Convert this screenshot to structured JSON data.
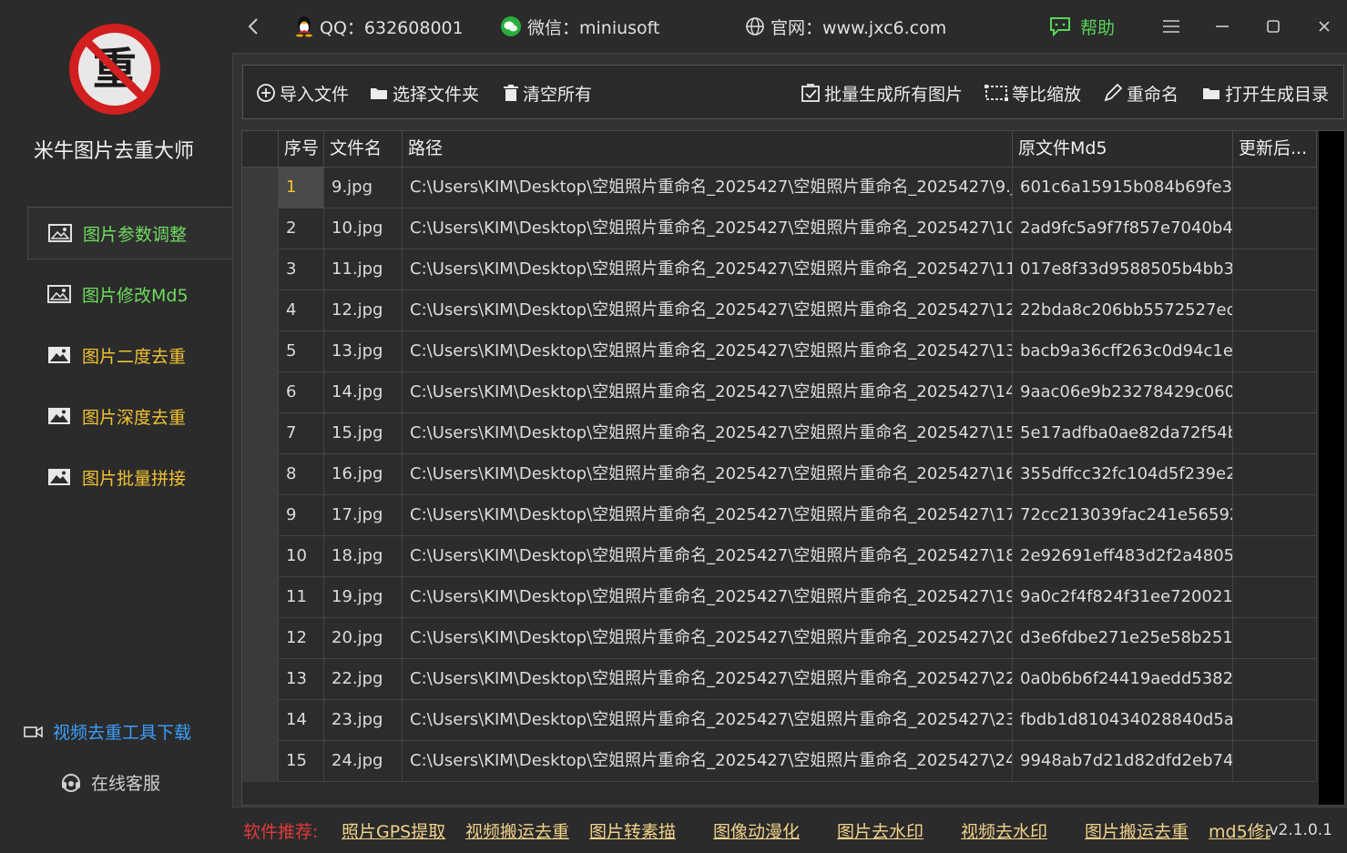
{
  "app": {
    "name": "米牛图片去重大师",
    "logo_glyph": "重"
  },
  "topbar": {
    "qq": "QQ：632608001",
    "wechat": "微信：miniusoft",
    "website": "官网：www.jxc6.com",
    "help": "帮助"
  },
  "sidebar": {
    "items": [
      {
        "label": "图片参数调整",
        "active": true
      },
      {
        "label": "图片修改Md5",
        "active": false
      },
      {
        "label": "图片二度去重",
        "active": false
      },
      {
        "label": "图片深度去重",
        "active": false
      },
      {
        "label": "图片批量拼接",
        "active": false
      }
    ],
    "video_tool": "视频去重工具下载",
    "online_service": "在线客服"
  },
  "toolbar": {
    "import": "导入文件",
    "select_folder": "选择文件夹",
    "clear_all": "清空所有",
    "batch_generate": "批量生成所有图片",
    "proportional_scale": "等比缩放",
    "rename": "重命名",
    "open_output": "打开生成目录"
  },
  "table": {
    "headers": [
      "序号",
      "文件名",
      "路径",
      "原文件Md5",
      "更新后..."
    ],
    "rows": [
      {
        "idx": "1",
        "name": "9.jpg",
        "path": "C:\\Users\\KIM\\Desktop\\空姐照片重命名_2025427\\空姐照片重命名_2025427\\9.j...",
        "md5": "601c6a15915b084b69fe3..."
      },
      {
        "idx": "2",
        "name": "10.jpg",
        "path": "C:\\Users\\KIM\\Desktop\\空姐照片重命名_2025427\\空姐照片重命名_2025427\\10....",
        "md5": "2ad9fc5a9f7f857e7040b4..."
      },
      {
        "idx": "3",
        "name": "11.jpg",
        "path": "C:\\Users\\KIM\\Desktop\\空姐照片重命名_2025427\\空姐照片重命名_2025427\\11....",
        "md5": "017e8f33d9588505b4bb3..."
      },
      {
        "idx": "4",
        "name": "12.jpg",
        "path": "C:\\Users\\KIM\\Desktop\\空姐照片重命名_2025427\\空姐照片重命名_2025427\\12....",
        "md5": "22bda8c206bb5572527ec..."
      },
      {
        "idx": "5",
        "name": "13.jpg",
        "path": "C:\\Users\\KIM\\Desktop\\空姐照片重命名_2025427\\空姐照片重命名_2025427\\13....",
        "md5": "bacb9a36cff263c0d94c1ef..."
      },
      {
        "idx": "6",
        "name": "14.jpg",
        "path": "C:\\Users\\KIM\\Desktop\\空姐照片重命名_2025427\\空姐照片重命名_2025427\\14....",
        "md5": "9aac06e9b23278429c060..."
      },
      {
        "idx": "7",
        "name": "15.jpg",
        "path": "C:\\Users\\KIM\\Desktop\\空姐照片重命名_2025427\\空姐照片重命名_2025427\\15....",
        "md5": "5e17adfba0ae82da72f54b..."
      },
      {
        "idx": "8",
        "name": "16.jpg",
        "path": "C:\\Users\\KIM\\Desktop\\空姐照片重命名_2025427\\空姐照片重命名_2025427\\16....",
        "md5": "355dffcc32fc104d5f239e2..."
      },
      {
        "idx": "9",
        "name": "17.jpg",
        "path": "C:\\Users\\KIM\\Desktop\\空姐照片重命名_2025427\\空姐照片重命名_2025427\\17....",
        "md5": "72cc213039fac241e56592..."
      },
      {
        "idx": "10",
        "name": "18.jpg",
        "path": "C:\\Users\\KIM\\Desktop\\空姐照片重命名_2025427\\空姐照片重命名_2025427\\18....",
        "md5": "2e92691eff483d2f2a4805..."
      },
      {
        "idx": "11",
        "name": "19.jpg",
        "path": "C:\\Users\\KIM\\Desktop\\空姐照片重命名_2025427\\空姐照片重命名_2025427\\19....",
        "md5": "9a0c2f4f824f31ee720021..."
      },
      {
        "idx": "12",
        "name": "20.jpg",
        "path": "C:\\Users\\KIM\\Desktop\\空姐照片重命名_2025427\\空姐照片重命名_2025427\\20....",
        "md5": "d3e6fdbe271e25e58b251..."
      },
      {
        "idx": "13",
        "name": "22.jpg",
        "path": "C:\\Users\\KIM\\Desktop\\空姐照片重命名_2025427\\空姐照片重命名_2025427\\22....",
        "md5": "0a0b6b6f24419aedd5382..."
      },
      {
        "idx": "14",
        "name": "23.jpg",
        "path": "C:\\Users\\KIM\\Desktop\\空姐照片重命名_2025427\\空姐照片重命名_2025427\\23....",
        "md5": "fbdb1d810434028840d5a..."
      },
      {
        "idx": "15",
        "name": "24.jpg",
        "path": "C:\\Users\\KIM\\Desktop\\空姐照片重命名_2025427\\空姐照片重命名_2025427\\24....",
        "md5": "9948ab7d21d82dfd2eb74..."
      }
    ]
  },
  "footer": {
    "recommend_label": "软件推荐:",
    "links": [
      "照片GPS提取",
      "视频搬运去重",
      "图片转素描",
      "图像动漫化",
      "图片去水印",
      "视频去水印",
      "图片搬运去重",
      "md5修改"
    ],
    "version": "v2.1.0.1"
  },
  "colors": {
    "accent_green": "#6fdc5f",
    "accent_yellow": "#f1c232",
    "link_blue": "#3aa0ff",
    "recommend_red": "#e03a3a",
    "background": "#2b2b2b"
  }
}
